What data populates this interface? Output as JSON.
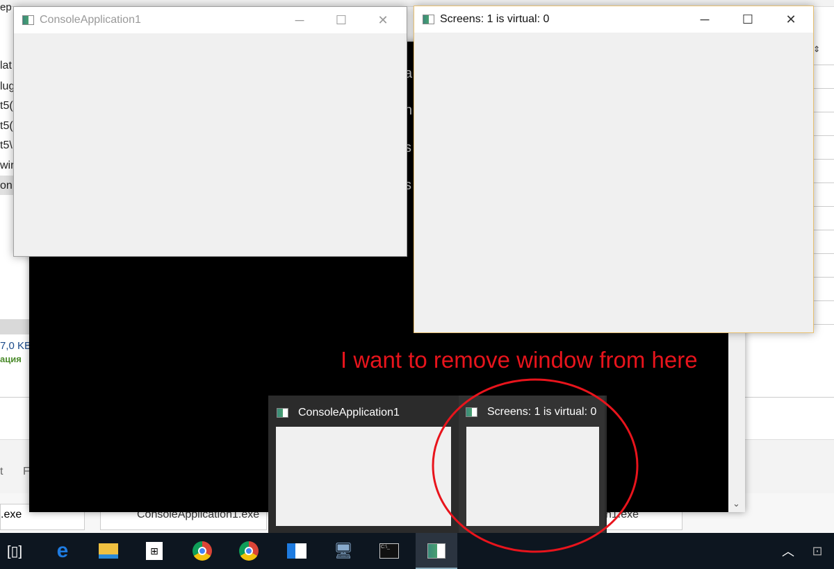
{
  "background": {
    "fragments": [
      "lat",
      "lug",
      "t5(",
      "t5(",
      "t5\\",
      "wir",
      "on"
    ],
    "top_fragment": "ep",
    "size": "7,0 KB",
    "green_text": "ация",
    "menu_fragments": [
      "t",
      "F"
    ],
    "tabs": [
      ".exe",
      "ConsoleApplication1.exe",
      "n1.exe"
    ],
    "console_letters": [
      "a",
      "h",
      "s",
      "s"
    ]
  },
  "window1": {
    "title": "ConsoleApplication1"
  },
  "window2": {
    "title": "Screens: 1 is virtual: 0"
  },
  "preview": {
    "items": [
      {
        "title": "ConsoleApplication1"
      },
      {
        "title": "Screens: 1 is virtual: 0"
      }
    ]
  },
  "annotation": {
    "text": "I want to remove window from here",
    "color": "#e8141c"
  },
  "taskbar": {
    "icons": [
      "task-view",
      "edge",
      "file-explorer",
      "store",
      "chrome",
      "chrome",
      "app",
      "remote-desktop",
      "cmd",
      "console-app"
    ]
  }
}
